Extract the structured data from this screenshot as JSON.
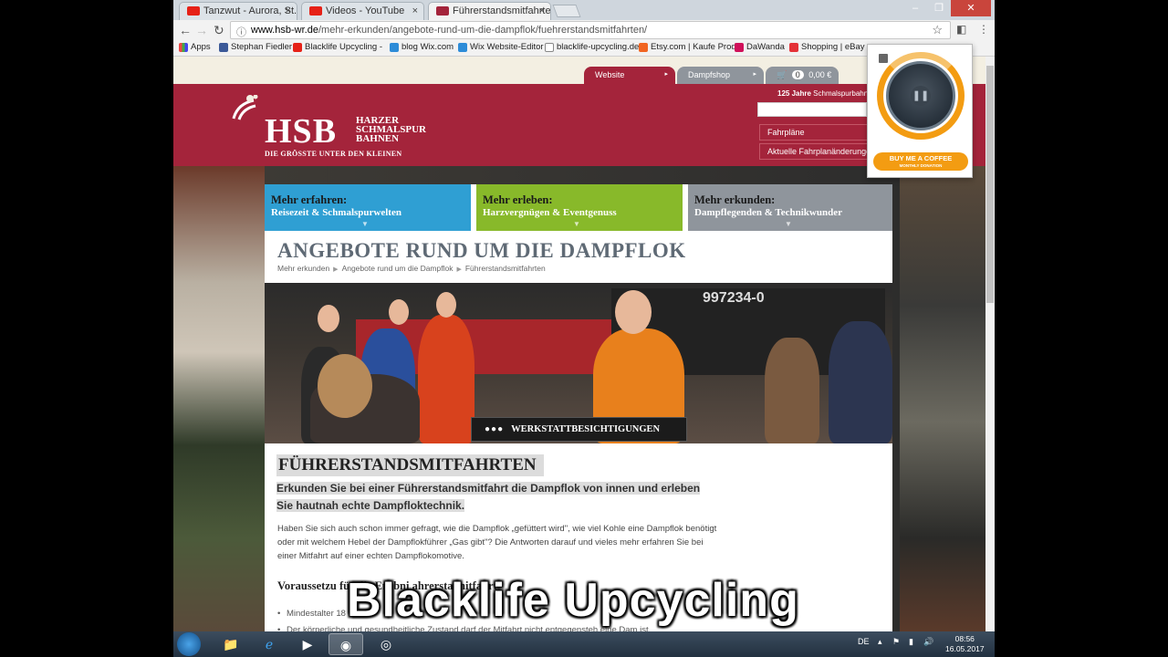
{
  "browser": {
    "tabs": [
      {
        "label": "Tanzwut - Aurora, St. Pet",
        "icon": "youtube-icon"
      },
      {
        "label": "Videos - YouTube",
        "icon": "youtube-icon"
      },
      {
        "label": "Führerstandsmitfahrten",
        "icon": "hsb-icon"
      }
    ],
    "url_host": "www.hsb-wr.de",
    "url_path": "/mehr-erkunden/angebote-rund-um-die-dampflok/fuehrerstandsmitfahrten/",
    "bookmarks": [
      {
        "label": "Apps",
        "color": "#e44"
      },
      {
        "label": "Stephan Fiedler",
        "color": "#3b5998"
      },
      {
        "label": "Blacklife Upcycling - ",
        "color": "#e62117"
      },
      {
        "label": "blog Wix.com",
        "color": "#2d8cd8"
      },
      {
        "label": "Wix Website-Editor",
        "color": "#2d8cd8"
      },
      {
        "label": "blacklife-upcycling.de",
        "color": "#888"
      },
      {
        "label": "Etsy.com | Kaufe Prod",
        "color": "#f16521"
      },
      {
        "label": "DaWanda",
        "color": "#d0105a"
      },
      {
        "label": "Shopping | eBay",
        "color": "#e43137"
      }
    ]
  },
  "site": {
    "tabs": {
      "website": "Website",
      "shop": "Dampfshop",
      "cart_count": "0",
      "cart_total": "0,00 €"
    },
    "logo": {
      "short": "HSB",
      "line1": "HARZER",
      "line2": "SCHMALSPUR",
      "line3": "BAHNEN",
      "tagline": "DIE GRÖSSTE UNTER DEN KLEINEN"
    },
    "years_label": "125 Jahre",
    "years_text": "Schmalspurbahnen",
    "header_buttons": [
      "Fahrpläne",
      "Aktuelle Fahrplanänderungen"
    ],
    "tiles": [
      {
        "title": "Mehr erfahren:",
        "subtitle": "Reisezeit & Schmalspurwelten",
        "color": "#2f9fd3"
      },
      {
        "title": "Mehr erleben:",
        "subtitle": "Harzvergnügen & Eventgenuss",
        "color": "#88b92a"
      },
      {
        "title": "Mehr erkunden:",
        "subtitle": "Dampflegenden & Technikwunder",
        "color": "#8f959c"
      }
    ],
    "page_title": "ANGEBOTE RUND UM DIE DAMPFLOK",
    "breadcrumbs": [
      "Mehr erkunden",
      "Angebote rund um die Dampflok",
      "Führerstandsmitfahrten"
    ],
    "hero": {
      "loco_number": "997234-0",
      "caption": "WERKSTATTBESICHTIGUNGEN",
      "dots": "●●●"
    },
    "heading": "FÜHRERSTANDSMITFAHRTEN",
    "lead": "Erkunden Sie bei einer Führerstandsmitfahrt die Dampflok von innen und erleben Sie hautnah echte Dampfloktechnik.",
    "body": "Haben Sie sich auch schon immer gefragt, wie die Dampflok „gefüttert wird\", wie viel Kohle eine Dampflok benötigt oder mit welchem Hebel der Dampflokführer „Gas gibt\"? Die Antworten darauf und vieles mehr erfahren Sie bei einer Mitfahrt auf einer echten Dampflokomotive.",
    "subheading": "Voraussetzu     für die Erl   bni    ahrersta    mitfahrt",
    "bullets": [
      "Mindestalter 18",
      "Der körperliche und gesundheitliche Zustand darf der Mitfahrt nicht entgegensteh       eine Dam       ist"
    ]
  },
  "overlay": {
    "watermark": "Blacklife Upcycling"
  },
  "extension": {
    "coffee": "BUY ME A COFFEE",
    "coffee_sub": "MONTHLY DONATION"
  },
  "taskbar": {
    "lang": "DE",
    "time": "08:56",
    "date": "16.05.2017"
  }
}
